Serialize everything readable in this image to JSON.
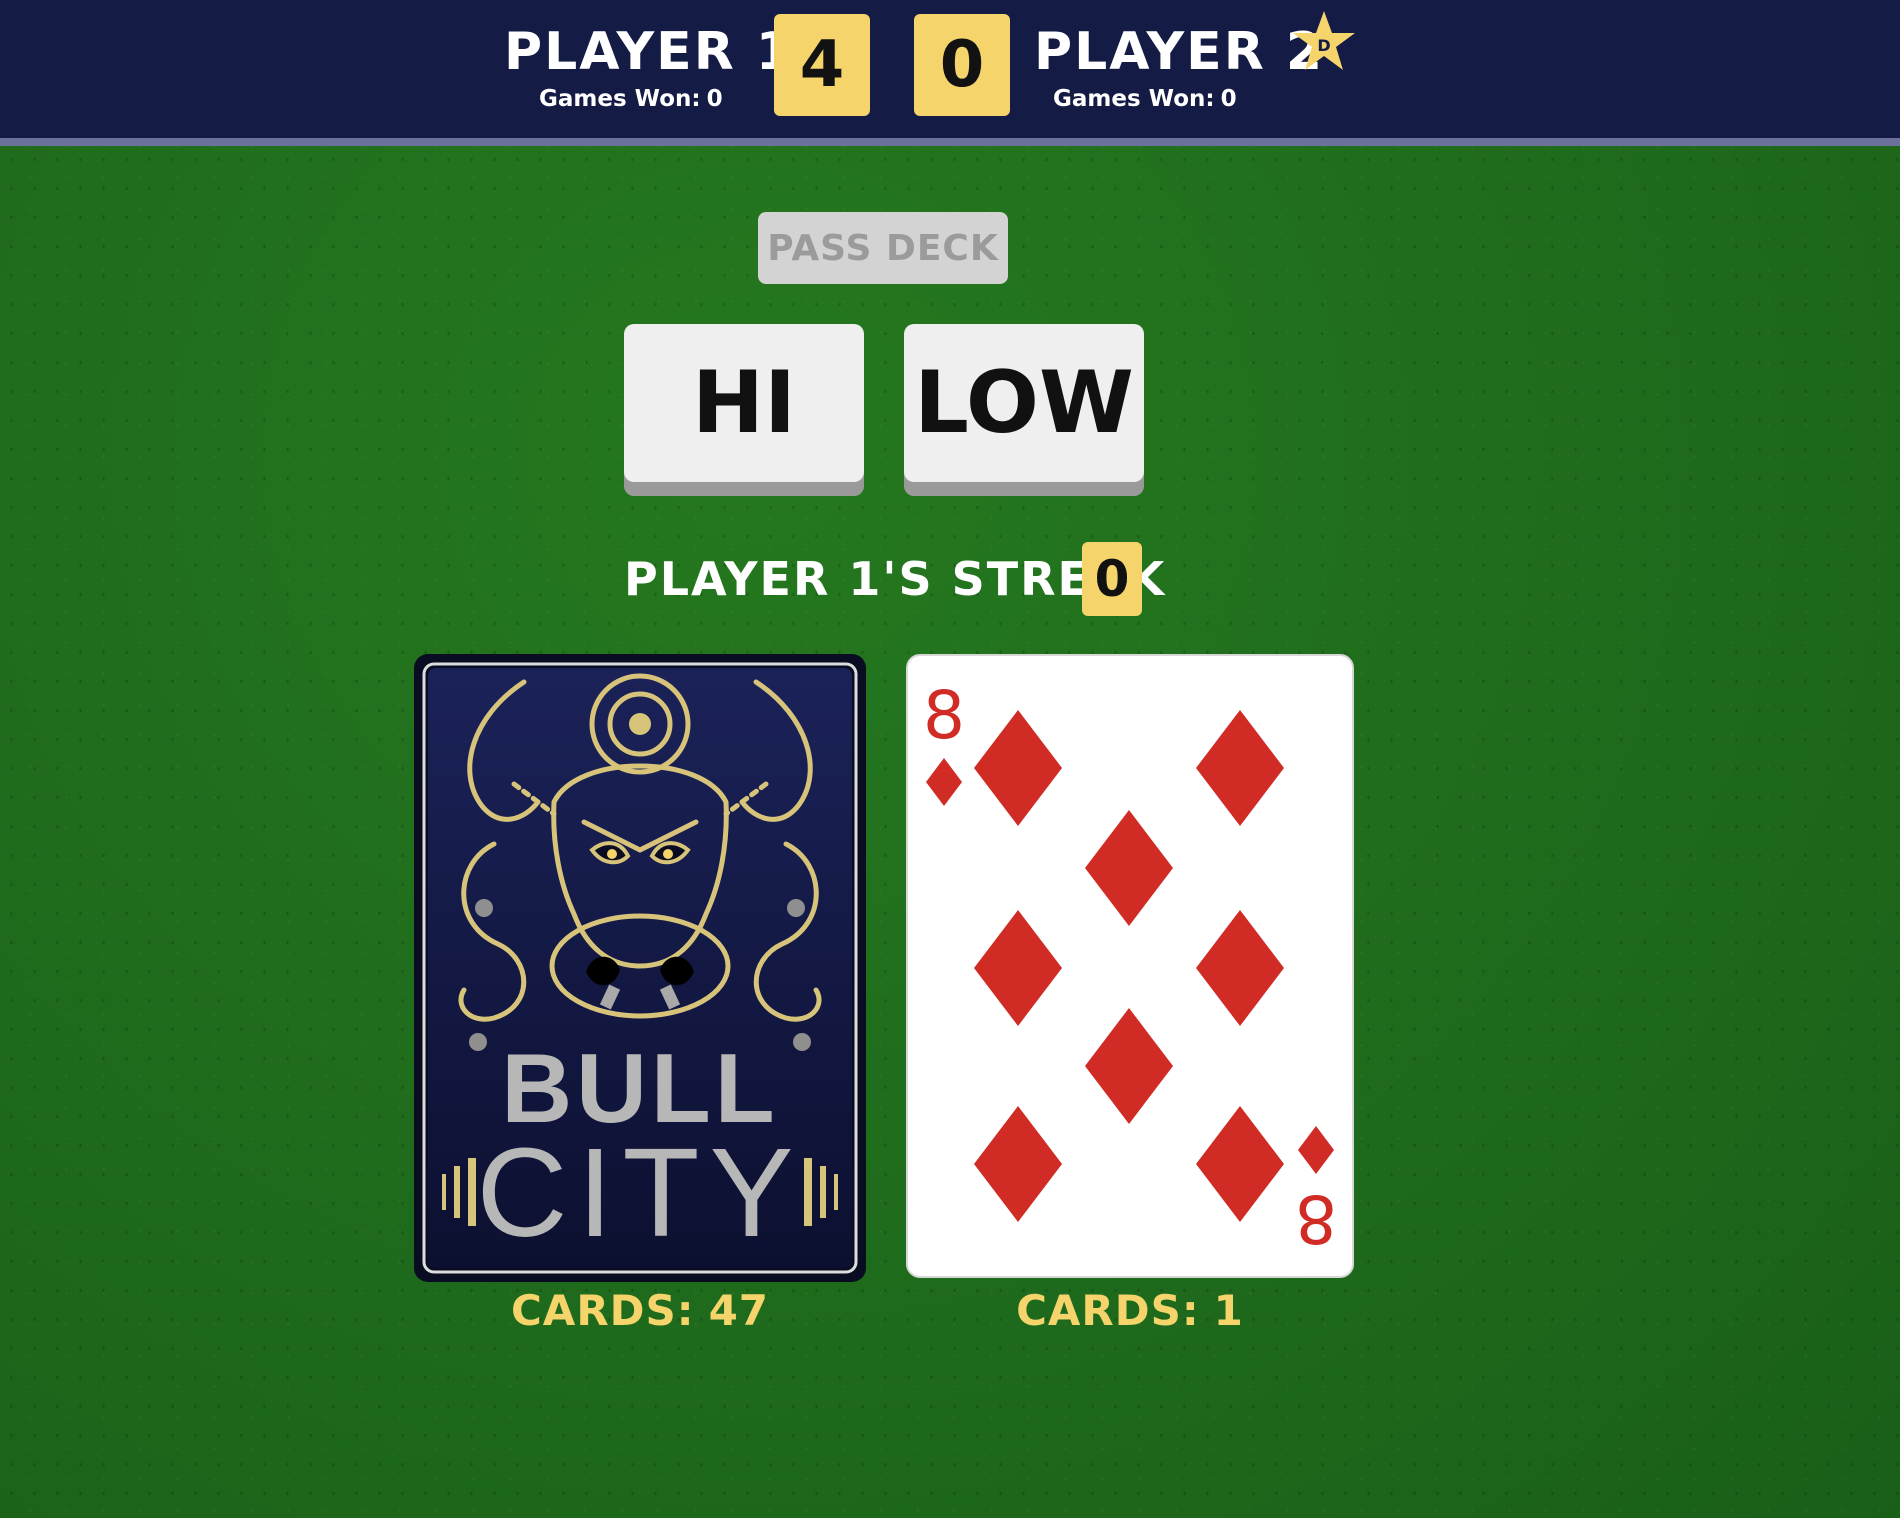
{
  "header": {
    "player1": {
      "name": "PLAYER 1",
      "games_won_label": "Games Won:",
      "games_won": "0",
      "score": "4"
    },
    "player2": {
      "name": "PLAYER 2",
      "games_won_label": "Games Won:",
      "games_won": "0",
      "score": "0"
    },
    "dealer_badge": {
      "icon": "star-icon",
      "letter": "D"
    }
  },
  "controls": {
    "pass_deck_label": "PASS DECK",
    "hi_label": "HI",
    "low_label": "LOW"
  },
  "streak": {
    "label": "PLAYER 1'S STREAK",
    "value": "0"
  },
  "deck": {
    "back_brand_line1": "BULL",
    "back_brand_line2": "CITY",
    "count_label": "CARDS:",
    "count": "47"
  },
  "pile": {
    "rank": "8",
    "suit": "diamonds",
    "suit_icon": "diamond-icon",
    "count_label": "CARDS:",
    "count": "1"
  },
  "colors": {
    "header_bg": "#141b45",
    "header_border": "#6b719b",
    "felt": "#1e6a1d",
    "accent_yellow": "#f4d46b",
    "button_face": "#efefef",
    "button_shadow": "#9a9a9a",
    "pass_button_bg": "#d3d3d3",
    "pass_button_text": "#9b9b9b",
    "diamond_red": "#d02b24",
    "card_back_gold": "#d7c47a",
    "card_back_navy": "#141a44"
  }
}
